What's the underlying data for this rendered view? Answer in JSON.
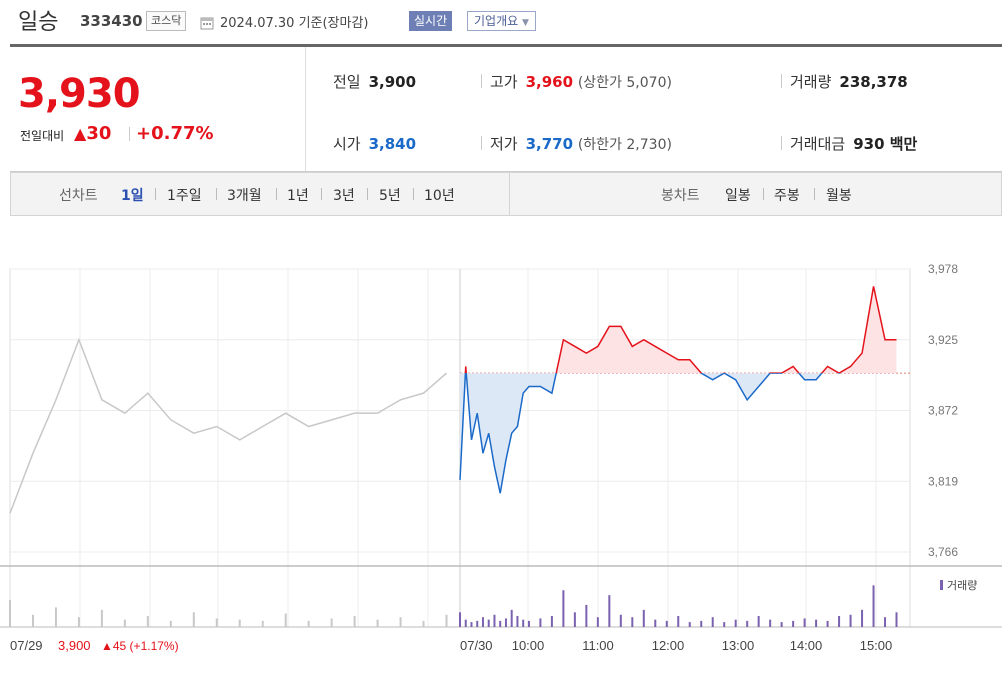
{
  "header": {
    "name": "일승",
    "code": "333430",
    "market": "코스닥",
    "date_text": "2024.07.30  기준(장마감)",
    "realtime": "실시간",
    "company_overview": "기업개요"
  },
  "summary": {
    "price": "3,930",
    "diff_label": "전일대비",
    "diff_value": "30",
    "diff_pct": "+0.77%",
    "prev_close_label": "전일",
    "prev_close": "3,900",
    "open_label": "시가",
    "open": "3,840",
    "high_label": "고가",
    "high": "3,960",
    "upper_limit": "(상한가 5,070)",
    "low_label": "저가",
    "low": "3,770",
    "lower_limit": "(하한가 2,730)",
    "volume_label": "거래량",
    "volume": "238,378",
    "amount_label": "거래대금",
    "amount": "930 백만"
  },
  "periods": {
    "line_chart_label": "선차트",
    "line_items": [
      "1일",
      "1주일",
      "3개월",
      "1년",
      "3년",
      "5년",
      "10년"
    ],
    "active": "1일",
    "candle_label": "봉차트",
    "candle_items": [
      "일봉",
      "주봉",
      "월봉"
    ]
  },
  "colors": {
    "up": "#e4121a",
    "down": "#1b6ac9",
    "prev": "#c8c8c8",
    "volume": "#7b62b0"
  },
  "chart_data": {
    "type": "line",
    "title": "",
    "ylabel": "",
    "y_ticks": [
      "3,978",
      "3,925",
      "3,872",
      "3,819",
      "3,766"
    ],
    "ylim": [
      3766,
      3978
    ],
    "baseline": 3900,
    "x_ticks": [
      "07/29",
      "07/30",
      "10:00",
      "11:00",
      "12:00",
      "13:00",
      "14:00",
      "15:00"
    ],
    "prev_day_label": "07/29",
    "prev_day_close": "3,900",
    "prev_day_change": "▲45 (+1.17%)",
    "volume_legend": "거래량",
    "grid": true,
    "series": [
      {
        "name": "07/29",
        "x": [
          "09:00",
          "09:20",
          "09:40",
          "10:00",
          "10:20",
          "10:40",
          "11:00",
          "11:20",
          "11:40",
          "12:00",
          "12:20",
          "12:40",
          "13:00",
          "13:20",
          "13:40",
          "14:00",
          "14:20",
          "14:40",
          "15:00",
          "15:20"
        ],
        "values": [
          3795,
          3840,
          3880,
          3925,
          3880,
          3870,
          3885,
          3865,
          3855,
          3860,
          3850,
          3860,
          3870,
          3860,
          3865,
          3870,
          3870,
          3880,
          3885,
          3900
        ]
      },
      {
        "name": "07/30",
        "x": [
          "09:00",
          "09:05",
          "09:10",
          "09:15",
          "09:20",
          "09:25",
          "09:30",
          "09:35",
          "09:40",
          "09:45",
          "09:50",
          "09:55",
          "10:00",
          "10:10",
          "10:20",
          "10:30",
          "10:40",
          "10:50",
          "11:00",
          "11:10",
          "11:20",
          "11:30",
          "11:40",
          "11:50",
          "12:00",
          "12:10",
          "12:20",
          "12:30",
          "12:40",
          "12:50",
          "13:00",
          "13:10",
          "13:20",
          "13:30",
          "13:40",
          "13:50",
          "14:00",
          "14:10",
          "14:20",
          "14:30",
          "14:40",
          "14:50",
          "15:00",
          "15:10",
          "15:20"
        ],
        "values": [
          3820,
          3905,
          3850,
          3870,
          3840,
          3855,
          3830,
          3810,
          3835,
          3855,
          3860,
          3885,
          3890,
          3890,
          3885,
          3925,
          3920,
          3915,
          3920,
          3935,
          3935,
          3920,
          3925,
          3920,
          3915,
          3910,
          3910,
          3900,
          3895,
          3900,
          3895,
          3880,
          3890,
          3900,
          3900,
          3905,
          3895,
          3895,
          3905,
          3900,
          3905,
          3915,
          3965,
          3925,
          3925
        ]
      }
    ],
    "volume": {
      "series": [
        {
          "name": "07/29",
          "values": [
            22,
            10,
            16,
            8,
            14,
            6,
            9,
            5,
            12,
            7,
            6,
            5,
            11,
            5,
            7,
            9,
            6,
            8,
            5,
            10
          ]
        },
        {
          "name": "07/30",
          "values": [
            12,
            6,
            4,
            5,
            8,
            6,
            10,
            5,
            7,
            14,
            9,
            6,
            5,
            7,
            9,
            30,
            12,
            18,
            8,
            26,
            10,
            8,
            14,
            6,
            5,
            9,
            4,
            5,
            8,
            4,
            6,
            5,
            9,
            6,
            4,
            5,
            7,
            6,
            5,
            9,
            10,
            14,
            34,
            8,
            12
          ]
        }
      ]
    }
  }
}
